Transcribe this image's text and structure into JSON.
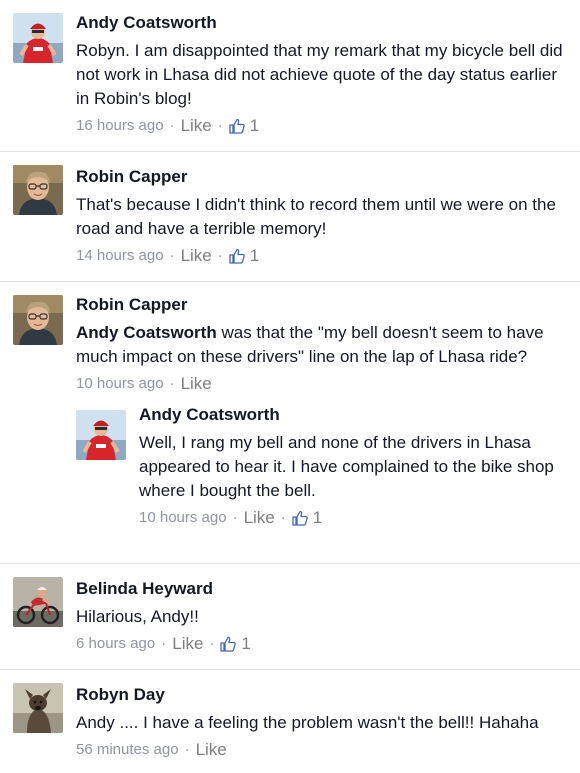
{
  "comments": [
    {
      "author": "Andy Coatsworth",
      "text": "Robyn. I am disappointed that my remark that my bicycle bell did not work in Lhasa did not achieve quote of the day status earlier in Robin's blog!",
      "time": "16 hours ago",
      "like_label": "Like",
      "like_count": "1",
      "avatar_icon": "cyclist-red-jersey-icon"
    },
    {
      "author": "Robin Capper",
      "text": "That's because I didn't think to record them until we were on the road and have a terrible memory!",
      "time": "14 hours ago",
      "like_label": "Like",
      "like_count": "1",
      "avatar_icon": "man-with-glasses-icon"
    },
    {
      "author": "Robin Capper",
      "mention": "Andy Coatsworth",
      "text": " was that the \"my bell doesn't seem to have much impact on these drivers\" line on the lap of Lhasa ride?",
      "time": "10 hours ago",
      "like_label": "Like",
      "avatar_icon": "man-with-glasses-icon",
      "reply": {
        "author": "Andy Coatsworth",
        "text": "Well, I rang my bell and none of the drivers in Lhasa appeared to hear it. I have complained to the bike shop where I bought the bell.",
        "time": "10 hours ago",
        "like_label": "Like",
        "like_count": "1",
        "avatar_icon": "cyclist-red-jersey-icon"
      }
    },
    {
      "author": "Belinda Heyward",
      "text": "Hilarious, Andy!!",
      "time": "6 hours ago",
      "like_label": "Like",
      "like_count": "1",
      "avatar_icon": "cyclist-on-bike-icon"
    },
    {
      "author": "Robyn Day",
      "text": "Andy .... I have a feeling the problem wasn't the bell!! Hahaha",
      "time": "56 minutes ago",
      "like_label": "Like",
      "avatar_icon": "dog-icon"
    }
  ],
  "separator": "·",
  "colors": {
    "text": "#141823",
    "meta": "#90949c",
    "like_icon": "#4267b2",
    "divider": "#dfe1e6"
  }
}
